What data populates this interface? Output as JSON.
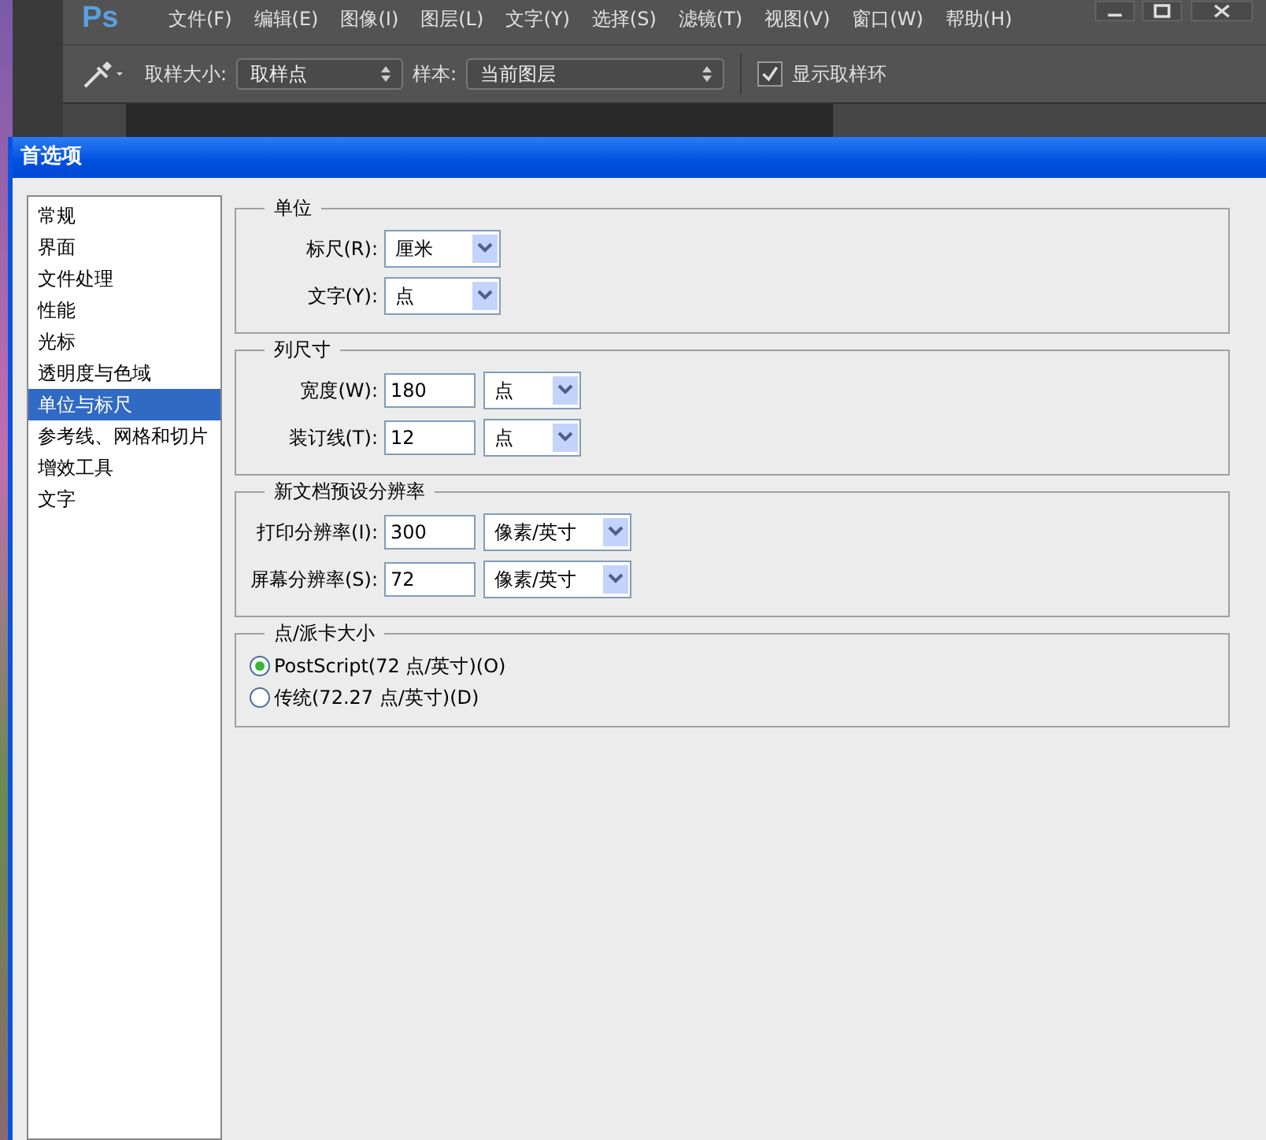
{
  "app": {
    "logo": "Ps",
    "menu": [
      "文件(F)",
      "编辑(E)",
      "图像(I)",
      "图层(L)",
      "文字(Y)",
      "选择(S)",
      "滤镜(T)",
      "视图(V)",
      "窗口(W)",
      "帮助(H)"
    ]
  },
  "options_bar": {
    "sample_size_label": "取样大小:",
    "sample_size": "取样点",
    "sample_label": "样本:",
    "sample": "当前图层",
    "show_ring": {
      "label": "显示取样环",
      "checked": true
    }
  },
  "dialog": {
    "title": "首选项",
    "categories": [
      {
        "label": "常规",
        "selected": false
      },
      {
        "label": "界面",
        "selected": false
      },
      {
        "label": "文件处理",
        "selected": false
      },
      {
        "label": "性能",
        "selected": false
      },
      {
        "label": "光标",
        "selected": false
      },
      {
        "label": "透明度与色域",
        "selected": false
      },
      {
        "label": "单位与标尺",
        "selected": true
      },
      {
        "label": "参考线、网格和切片",
        "selected": false
      },
      {
        "label": "增效工具",
        "selected": false
      },
      {
        "label": "文字",
        "selected": false
      }
    ],
    "groups": [
      {
        "title": "单位",
        "rows": [
          {
            "kind": "select",
            "label": "标尺(R):",
            "value": "厘米"
          },
          {
            "kind": "select",
            "label": "文字(Y):",
            "value": "点"
          }
        ]
      },
      {
        "title": "列尺寸",
        "rows": [
          {
            "kind": "input_select",
            "label": "宽度(W):",
            "value": "180",
            "unit": "点"
          },
          {
            "kind": "input_select",
            "label": "装订线(T):",
            "value": "12",
            "unit": "点"
          }
        ]
      },
      {
        "title": "新文档预设分辨率",
        "rows": [
          {
            "kind": "input_select",
            "label": "打印分辨率(I):",
            "value": "300",
            "unit": "像素/英寸"
          },
          {
            "kind": "input_select",
            "label": "屏幕分辨率(S):",
            "value": "72",
            "unit": "像素/英寸"
          }
        ]
      },
      {
        "title": "点/派卡大小",
        "rows": [
          {
            "kind": "radio",
            "label": "PostScript(72 点/英寸)(O)",
            "selected": true
          },
          {
            "kind": "radio",
            "label": "传统(72.27 点/英寸)(D)",
            "selected": false
          }
        ]
      }
    ]
  }
}
